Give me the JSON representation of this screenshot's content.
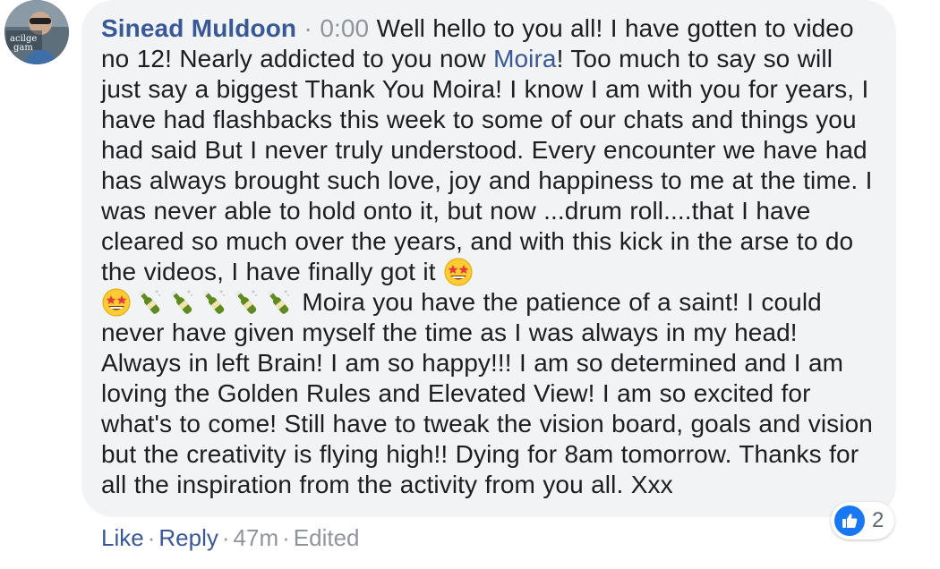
{
  "comment": {
    "author": "Sinead Muldoon",
    "timestamp_link": "0:00",
    "text_part1": "Well hello to you all! I have gotten to video no 12! Nearly addicted to you now ",
    "mention": "Moira",
    "text_part2": "! Too much to say so will just say a biggest Thank You Moira! I know I am with you for years, I have had flashbacks this week to some of our chats and things you had said But I never truly understood. Every encounter we have had has always brought such love, joy and happiness to me at the time. I was never able to hold onto it, but now ...drum roll....that I have cleared so much over the years, and with this kick in the arse to do the videos, I have finally got it ",
    "text_part3": " Moira you have the patience of a saint! I could never have given myself the time as I was always in my head! Always in left Brain! I am so happy!!! I am so determined and I am loving the Golden Rules and Elevated View! I am so excited for what's to come! Still have to tweak the vision board, goals and vision but the creativity is flying high!! Dying for 8am tomorrow. Thanks for all the inspiration from the activity from you all. Xxx",
    "emojis": [
      "star-struck",
      "star-struck",
      "champagne",
      "champagne",
      "champagne",
      "champagne",
      "champagne"
    ]
  },
  "actions": {
    "like": "Like",
    "reply": "Reply",
    "time": "47m",
    "edited": "Edited",
    "separator": "·"
  },
  "reactions": {
    "icon": "like-thumb",
    "count": "2"
  },
  "colors": {
    "link": "#385898",
    "meta": "#90949c",
    "bubble": "#f2f3f5",
    "text": "#1c1e21",
    "like_blue": "#1877f2"
  }
}
